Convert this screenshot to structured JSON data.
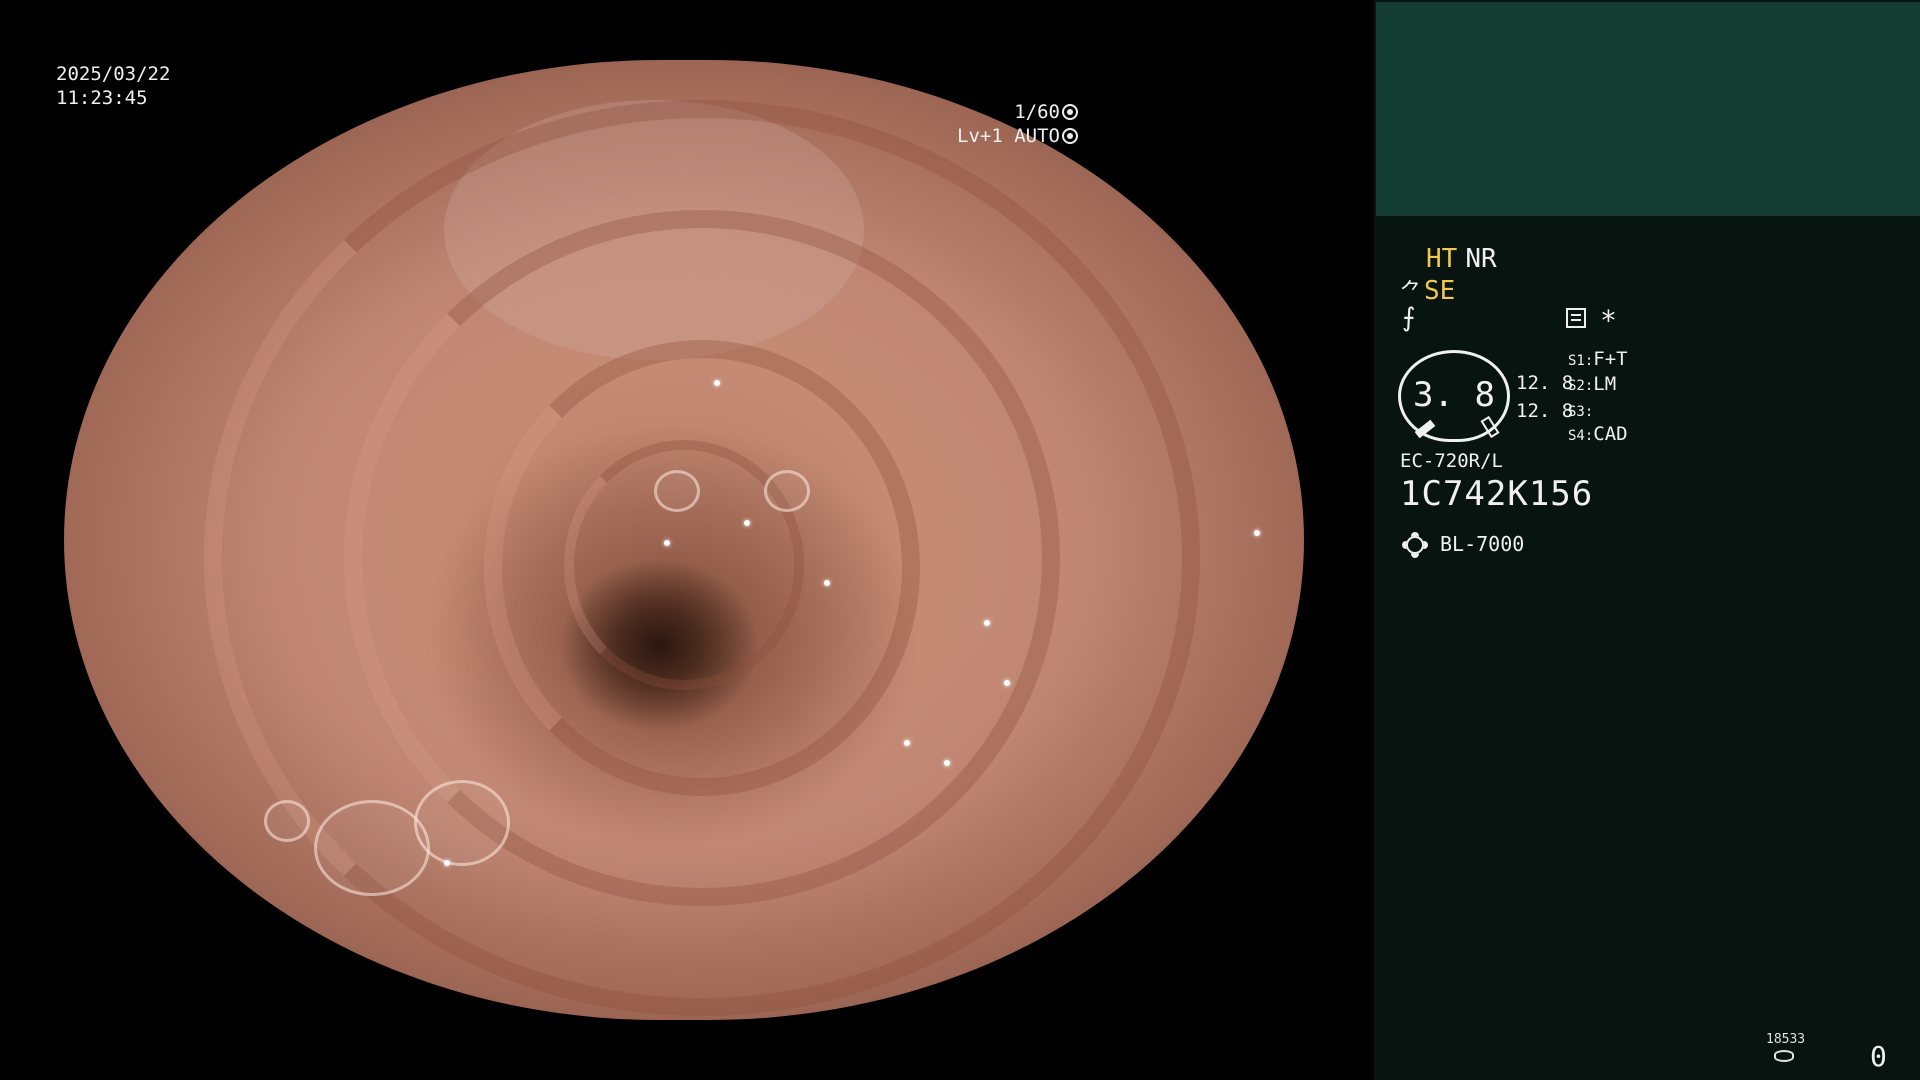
{
  "image_overlay": {
    "date": "2025/03/22",
    "time": "11:23:45",
    "shutter": "1/60",
    "shutter_icon": "aperture-icon",
    "level_mode": "Lv+1 AUTO",
    "mode_icon": "auto-iris-icon"
  },
  "panel": {
    "ht": "HT",
    "nr": "NR",
    "se": "SE",
    "se_prefix": "⺈",
    "fnot": "⨍",
    "menu_icon": "menu-icon",
    "asterisk": "*",
    "gauge_value": "3. 8",
    "gauge_val1": "12. 8",
    "gauge_val2": "12. 8",
    "settings": [
      {
        "key": "S1:",
        "value": "F+T"
      },
      {
        "key": "S2:",
        "value": "LM"
      },
      {
        "key": "S3:",
        "value": ""
      },
      {
        "key": "S4:",
        "value": "CAD"
      }
    ],
    "scope_model": "EC-720R/L",
    "serial": "1C742K156",
    "light_icon": "sun-icon",
    "light_source": "BL-7000",
    "counter_small": "18533",
    "counter_big": "0"
  },
  "colors": {
    "panel_bg": "#081410",
    "thumb_bg": "#133c33",
    "accent_yellow": "#f5c84a"
  }
}
